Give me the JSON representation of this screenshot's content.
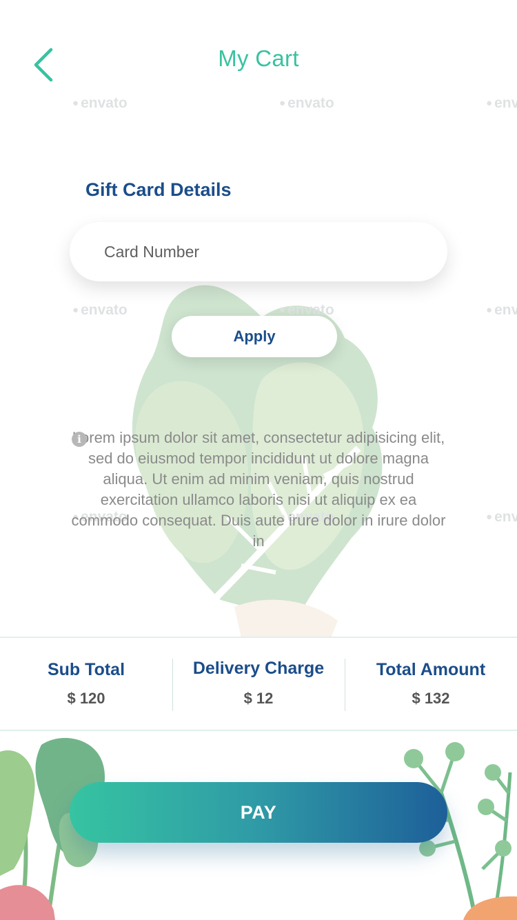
{
  "header": {
    "title": "My Cart",
    "back_icon": "chevron-left-icon"
  },
  "watermark": {
    "text": "envato"
  },
  "gift_card": {
    "section_title": "Gift Card Details",
    "card_number_placeholder": "Card Number",
    "apply_label": "Apply"
  },
  "info": {
    "icon": "info-icon",
    "icon_glyph": "i",
    "text": "Lorem ipsum dolor sit amet, consectetur adipisicing elit, sed do eiusmod tempor incididunt ut dolore magna aliqua. Ut enim ad minim veniam, quis nostrud exercitation ullamco laboris nisi ut aliquip ex ea commodo consequat. Duis aute irure dolor in irure dolor in"
  },
  "totals": {
    "subtotal_label": "Sub Total",
    "subtotal_value": "$ 120",
    "delivery_label": "Delivery Charge",
    "delivery_value": "$ 12",
    "total_label": "Total Amount",
    "total_value": "$ 132"
  },
  "actions": {
    "pay_label": "PAY"
  },
  "colors": {
    "accent": "#39c2a0",
    "heading": "#1b4d8a",
    "pay_gradient_start": "#36c4a2",
    "pay_gradient_end": "#1d5f99"
  }
}
